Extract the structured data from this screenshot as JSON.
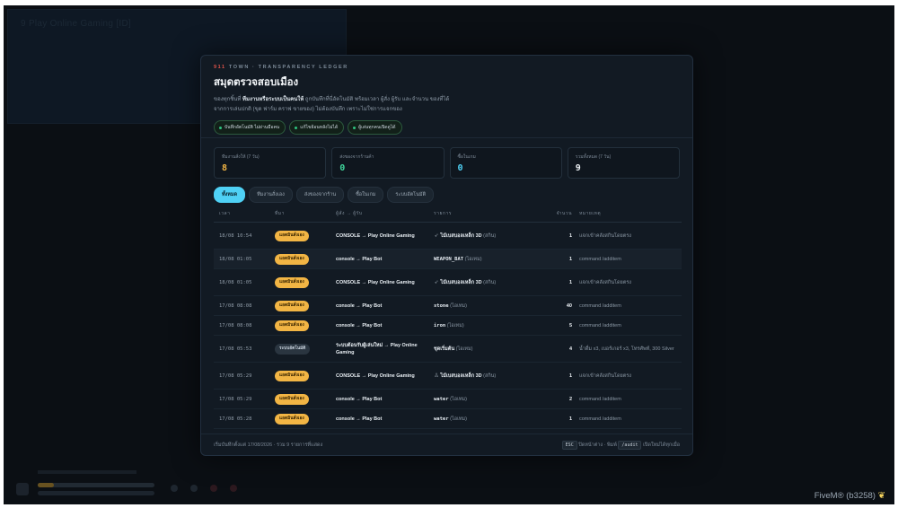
{
  "background": {
    "panel_title": "9 Play Online Gaming [ID]",
    "footer_brand": "FiveM® (b3258)"
  },
  "ledger": {
    "eyebrow_tag": "911",
    "eyebrow_text": "TOWN · TRANSPARENCY LEDGER",
    "title": "สมุดตรวจสอบเมือง",
    "desc_pre": "ของทุกชิ้นที่ ",
    "desc_bold": "ทีมงานหรือระบบเป็นคนให้",
    "desc_post": " ถูกบันทึกที่นี่อัตโนมัติ พร้อมเวลา ผู้สั่ง ผู้รับ และจำนวน ของที่ได้จากการเล่นปกติ (ขุด ฟาร์ม คราฟ ขายของ) ไม่ต้องบันทึก เพราะไม่ใช่การแจกของ",
    "tags": [
      "บันทึกอัตโนมัติ ไม่ผ่านมือคน",
      "แก้ไขย้อนหลังไม่ได้",
      "ผู้เล่นทุกคนเปิดดูได้"
    ],
    "stats": [
      {
        "label": "ทีมงานสั่งให้ (7 วัน)",
        "value": "8",
        "color": "#f2b544"
      },
      {
        "label": "ส่งของจากร้านค้า",
        "value": "0",
        "color": "#3fd49b"
      },
      {
        "label": "ซื้อในเกม",
        "value": "0",
        "color": "#4fd1f5"
      },
      {
        "label": "รวมทั้งหมด (7 วัน)",
        "value": "9",
        "color": "#eef2f6"
      }
    ],
    "filters": [
      "ทั้งหมด",
      "ทีมงานสั่งเอง",
      "ส่งของจากร้าน",
      "ซื้อในเกม",
      "ระบบอัตโนมัติ"
    ],
    "columns": {
      "time": "เวลา",
      "source": "ที่มา",
      "flow": "ผู้สั่ง → ผู้รับ",
      "item": "รายการ",
      "qty": "จำนวน",
      "note": "หมายเหตุ"
    },
    "rows": [
      {
        "time": "18/08 10:54",
        "badge": "แอดมินสั่งเอง",
        "kind": "staff",
        "flow": "CONSOLE → Play Online Gaming",
        "icon": "➶",
        "item_name": "ไม้เบสบอลเหล็ก",
        "item_code": "",
        "item_extra": "3D",
        "item_sub": "(สกิน)",
        "qty": "1",
        "note": "แจกเข้าคลังสกินโดยตรง"
      },
      {
        "time": "18/08 01:05",
        "badge": "แอดมินสั่งเอง",
        "kind": "staff",
        "flow": "console → Play Bot",
        "icon": "",
        "item_name": "",
        "item_code": "WEAPON_BAT",
        "item_extra": "",
        "item_sub": "(ไอเทม)",
        "qty": "1",
        "note": "command /additem"
      },
      {
        "time": "18/08 01:05",
        "badge": "แอดมินสั่งเอง",
        "kind": "staff",
        "flow": "CONSOLE → Play Online Gaming",
        "icon": "➶",
        "item_name": "ไม้เบสบอลเหล็ก",
        "item_code": "",
        "item_extra": "3D",
        "item_sub": "(สกิน)",
        "qty": "1",
        "note": "แจกเข้าคลังสกินโดยตรง"
      },
      {
        "time": "17/08 08:08",
        "badge": "แอดมินสั่งเอง",
        "kind": "staff",
        "flow": "console → Play Bot",
        "icon": "",
        "item_name": "",
        "item_code": "stone",
        "item_extra": "",
        "item_sub": "(ไอเทม)",
        "qty": "40",
        "note": "command /additem"
      },
      {
        "time": "17/08 08:08",
        "badge": "แอดมินสั่งเอง",
        "kind": "staff",
        "flow": "console → Play Bot",
        "icon": "",
        "item_name": "",
        "item_code": "iron",
        "item_extra": "",
        "item_sub": "(ไอเทม)",
        "qty": "5",
        "note": "command /additem"
      },
      {
        "time": "17/08 05:53",
        "badge": "ระบบอัตโนมัติ",
        "kind": "auto",
        "flow": "ระบบต้อนรับผู้เล่นใหม่ → Play Online Gaming",
        "icon": "",
        "item_name": "ชุดเริ่มต้น",
        "item_code": "",
        "item_extra": "",
        "item_sub": "(ไอเทม)",
        "qty": "4",
        "note": "น้ำดื่ม x3, เบอร์เกอร์ x3, โทรศัพท์, 300 Silver"
      },
      {
        "time": "17/08 05:29",
        "badge": "แอดมินสั่งเอง",
        "kind": "staff",
        "flow": "CONSOLE → Play Online Gaming",
        "icon": "♙",
        "item_name": "ไม้เบสบอลเหล็ก",
        "item_code": "",
        "item_extra": "3D",
        "item_sub": "(สกิน)",
        "qty": "1",
        "note": "แจกเข้าคลังสกินโดยตรง"
      },
      {
        "time": "17/08 05:29",
        "badge": "แอดมินสั่งเอง",
        "kind": "staff",
        "flow": "console → Play Bot",
        "icon": "",
        "item_name": "",
        "item_code": "water",
        "item_extra": "",
        "item_sub": "(ไอเทม)",
        "qty": "2",
        "note": "command /additem"
      },
      {
        "time": "17/08 05:28",
        "badge": "แอดมินสั่งเอง",
        "kind": "staff",
        "flow": "console → Play Bot",
        "icon": "",
        "item_name": "",
        "item_code": "water",
        "item_extra": "",
        "item_sub": "(ไอเทม)",
        "qty": "1",
        "note": "command /additem"
      }
    ],
    "footer_left": "เริ่มบันทึกตั้งแต่ 17/08/2026 · รวม 9 รายการที่แสดง",
    "footer_esc_key": "ESC",
    "footer_esc_text": "ปิดหน้าต่าง · พิมพ์",
    "footer_cmd": "/audit",
    "footer_cmd_text": "เปิดใหม่ได้ทุกเมื่อ"
  }
}
